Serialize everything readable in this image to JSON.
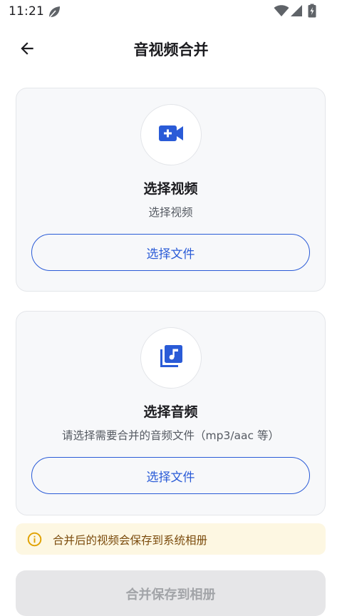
{
  "status_bar": {
    "time": "11:21",
    "icons": [
      "leaf-icon",
      "wifi-icon",
      "cell-signal-icon",
      "battery-charging-icon"
    ]
  },
  "app_bar": {
    "title": "音视频合并",
    "back_icon": "arrow-back-icon"
  },
  "video_card": {
    "icon": "video-add-icon",
    "title": "选择视频",
    "subtitle": "选择视频",
    "button_label": "选择文件"
  },
  "audio_card": {
    "icon": "music-library-icon",
    "title": "选择音频",
    "subtitle": "请选择需要合并的音频文件（mp3/aac 等）",
    "button_label": "选择文件"
  },
  "info_banner": {
    "icon": "info-icon",
    "text": "合并后的视频会保存到系统相册"
  },
  "merge_button": {
    "label": "合并保存到相册",
    "enabled": false
  },
  "colors": {
    "accent": "#2a5bd7",
    "card_background": "#f7f8fa",
    "banner_background": "#fdf7e2",
    "banner_text": "#7a4a0b",
    "disabled_background": "#e6e6e8",
    "disabled_text": "#a2a4a8"
  }
}
